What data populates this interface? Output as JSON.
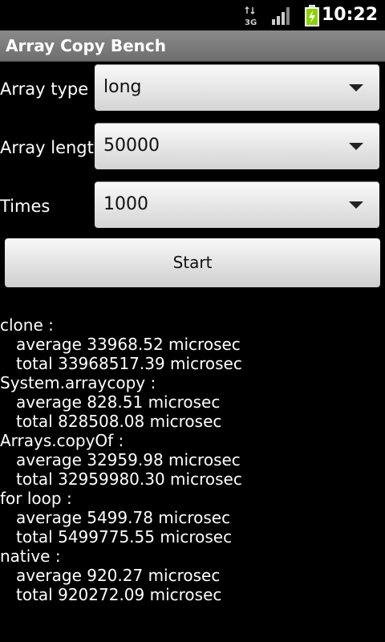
{
  "status_bar": {
    "network_label": "3G",
    "time": "10:22"
  },
  "app": {
    "title": "Array Copy Bench"
  },
  "form": {
    "array_type": {
      "label": "Array type",
      "value": "long"
    },
    "array_length": {
      "label": "Array length",
      "value": "50000"
    },
    "times": {
      "label": "Times",
      "value": "1000"
    },
    "start_label": "Start"
  },
  "results": [
    {
      "name": "clone :",
      "average": "average 33968.52 microsec",
      "total": "total 33968517.39 microsec"
    },
    {
      "name": "System.arraycopy :",
      "average": "average 828.51 microsec",
      "total": "total 828508.08 microsec"
    },
    {
      "name": "Arrays.copyOf :",
      "average": "average 32959.98 microsec",
      "total": "total 32959980.30 microsec"
    },
    {
      "name": "for loop :",
      "average": "average 5499.78 microsec",
      "total": "total 5499775.55 microsec"
    },
    {
      "name": "native :",
      "average": "average 920.27 microsec",
      "total": "total 920272.09 microsec"
    }
  ],
  "colors": {
    "background": "#000000",
    "titlebar": "#7a7a7a",
    "battery": "#8ad400"
  }
}
